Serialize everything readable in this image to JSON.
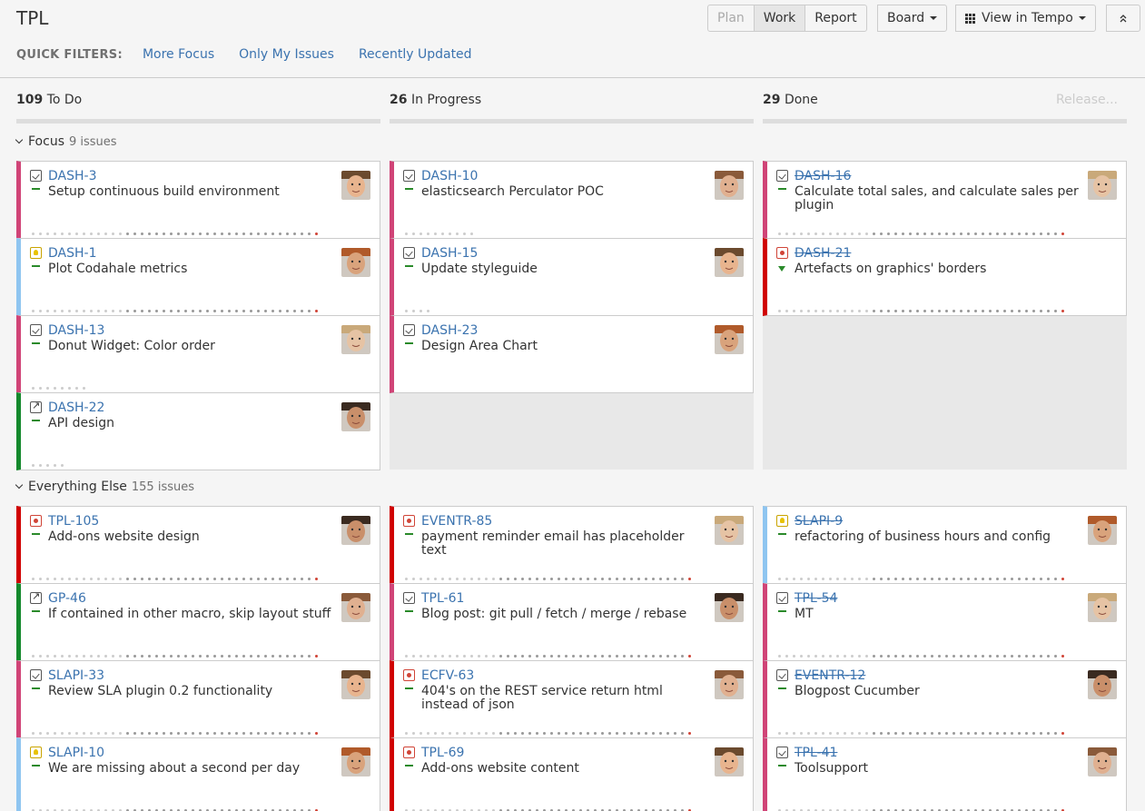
{
  "title": "TPL",
  "toolbar": {
    "plan": "Plan",
    "work": "Work",
    "report": "Report",
    "board": "Board",
    "tempo": "View in Tempo"
  },
  "quick_filters": {
    "label": "QUICK FILTERS:",
    "items": [
      "More Focus",
      "Only My Issues",
      "Recently Updated"
    ]
  },
  "columns": [
    {
      "count": "109",
      "name": "To Do"
    },
    {
      "count": "26",
      "name": "In Progress"
    },
    {
      "count": "29",
      "name": "Done",
      "action": "Release..."
    }
  ],
  "lanes": [
    {
      "name": "Focus",
      "count": "9 issues"
    },
    {
      "name": "Everything Else",
      "count": "155 issues"
    }
  ],
  "cards": {
    "focus_todo": [
      {
        "key": "DASH-3",
        "summary": "Setup continuous build environment",
        "type": "task-icon",
        "color": "#d04477"
      },
      {
        "key": "DASH-1",
        "summary": "Plot Codahale metrics",
        "type": "idea-icon",
        "color": "#8fc5f0"
      },
      {
        "key": "DASH-13",
        "summary": "Donut Widget: Color order",
        "type": "task-icon",
        "color": "#d04477"
      },
      {
        "key": "DASH-22",
        "summary": "API design",
        "type": "improvement-icon",
        "color": "#14892c"
      }
    ],
    "focus_progress": [
      {
        "key": "DASH-10",
        "summary": "elasticsearch Perculator POC",
        "type": "task-icon",
        "color": "#d04477"
      },
      {
        "key": "DASH-15",
        "summary": "Update styleguide",
        "type": "task-icon",
        "color": "#d04477"
      },
      {
        "key": "DASH-23",
        "summary": "Design Area Chart",
        "type": "task-icon",
        "color": "#d04477"
      }
    ],
    "focus_done": [
      {
        "key": "DASH-16",
        "summary": "Calculate total sales, and calculate sales per plugin",
        "type": "task-icon",
        "color": "#d04477"
      },
      {
        "key": "DASH-21",
        "summary": "Artefacts on graphics' borders",
        "type": "bug-icon",
        "color": "#d00000"
      }
    ],
    "else_todo": [
      {
        "key": "TPL-105",
        "summary": "Add-ons website design",
        "type": "bug-icon",
        "color": "#d00000"
      },
      {
        "key": "GP-46",
        "summary": "If contained in other macro, skip layout stuff",
        "type": "improvement-icon",
        "color": "#14892c"
      },
      {
        "key": "SLAPI-33",
        "summary": "Review SLA plugin 0.2 functionality",
        "type": "task-icon",
        "color": "#d04477"
      },
      {
        "key": "SLAPI-10",
        "summary": "We are missing about a second per day",
        "type": "idea-icon",
        "color": "#8fc5f0"
      }
    ],
    "else_progress": [
      {
        "key": "EVENTR-85",
        "summary": "payment reminder email has placeholder text",
        "type": "bug-icon",
        "color": "#d00000"
      },
      {
        "key": "TPL-61",
        "summary": "Blog post: git pull / fetch / merge / rebase",
        "type": "task-icon",
        "color": "#d04477"
      },
      {
        "key": "ECFV-63",
        "summary": "404's on the REST service return html instead of json",
        "type": "bug-icon",
        "color": "#d00000"
      },
      {
        "key": "TPL-69",
        "summary": "Add-ons website content",
        "type": "bug-icon",
        "color": "#d00000"
      }
    ],
    "else_done": [
      {
        "key": "SLAPI-9",
        "summary": "refactoring of business hours and config",
        "type": "idea-icon",
        "color": "#8fc5f0"
      },
      {
        "key": "TPL-54",
        "summary": "MT",
        "type": "task-icon",
        "color": "#d04477"
      },
      {
        "key": "EVENTR-12",
        "summary": "Blogpost Cucumber",
        "type": "task-icon",
        "color": "#d04477"
      },
      {
        "key": "TPL-41",
        "summary": "Toolsupport",
        "type": "task-icon",
        "color": "#d04477"
      }
    ]
  }
}
